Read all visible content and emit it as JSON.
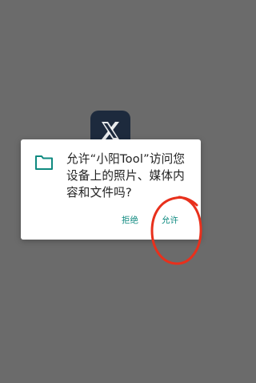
{
  "dialog": {
    "message": "允许“小阳Tool”访问您设备上的照片、媒体内容和文件吗?",
    "deny_label": "拒绝",
    "allow_label": "允许"
  },
  "colors": {
    "scrim": "#6b6b6b",
    "accent": "#0f8a80",
    "annotation": "#e8301c",
    "logo_bg": "#1d2a3d"
  },
  "icons": {
    "dialog_icon": "folder-icon",
    "app_logo": "x-logo-icon"
  }
}
